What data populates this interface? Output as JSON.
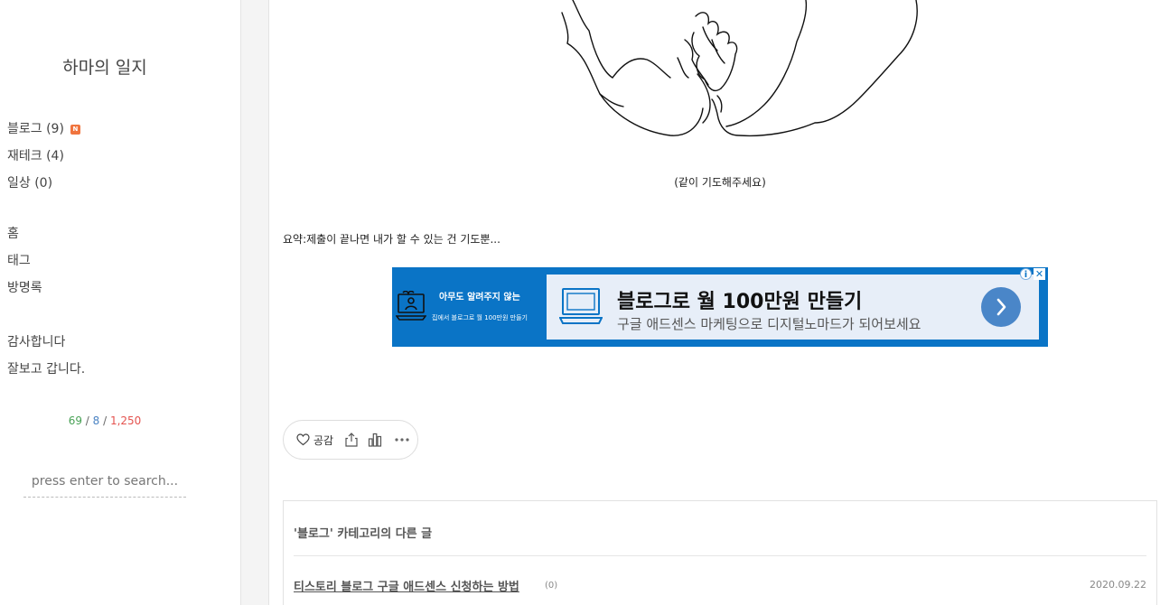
{
  "sidebar": {
    "blog_title": "하마의 일지",
    "categories": [
      {
        "label": "블로그",
        "count": "(9)",
        "new_badge": "N"
      },
      {
        "label": "재테크",
        "count": "(4)"
      },
      {
        "label": "일상",
        "count": "(0)"
      }
    ],
    "nav": [
      "홈",
      "태그",
      "방명록"
    ],
    "links": [
      "감사합니다",
      "잘보고 갑니다."
    ],
    "visitor": {
      "today": "69",
      "yesterday": "8",
      "total": "1,250",
      "separator": " / "
    },
    "search": {
      "placeholder": "press enter to search..."
    }
  },
  "post": {
    "caption": "(같이 기도해주세요)",
    "summary": "요약:제출이 끝나면 내가 할 수 있는 건 기도뿐..."
  },
  "ad": {
    "left_line1": "아무도 알려주지 않는",
    "left_line2": "집에서 블로그로 월 100만원 만들기",
    "headline": "블로그로 월 100만원 만들기",
    "subtext": "구글 애드센스 마케팅으로 디지털노마드가 되어보세요",
    "adchoices": "i",
    "close": "✕",
    "brand_color": "#0a74c6"
  },
  "reaction": {
    "like_label": "공감"
  },
  "related": {
    "title": "'블로그' 카테고리의 다른 글",
    "items": [
      {
        "title": "티스토리 블로그 구글 애드센스 신청하는 방법",
        "comments": "(0)",
        "date": "2020.09.22"
      }
    ]
  }
}
